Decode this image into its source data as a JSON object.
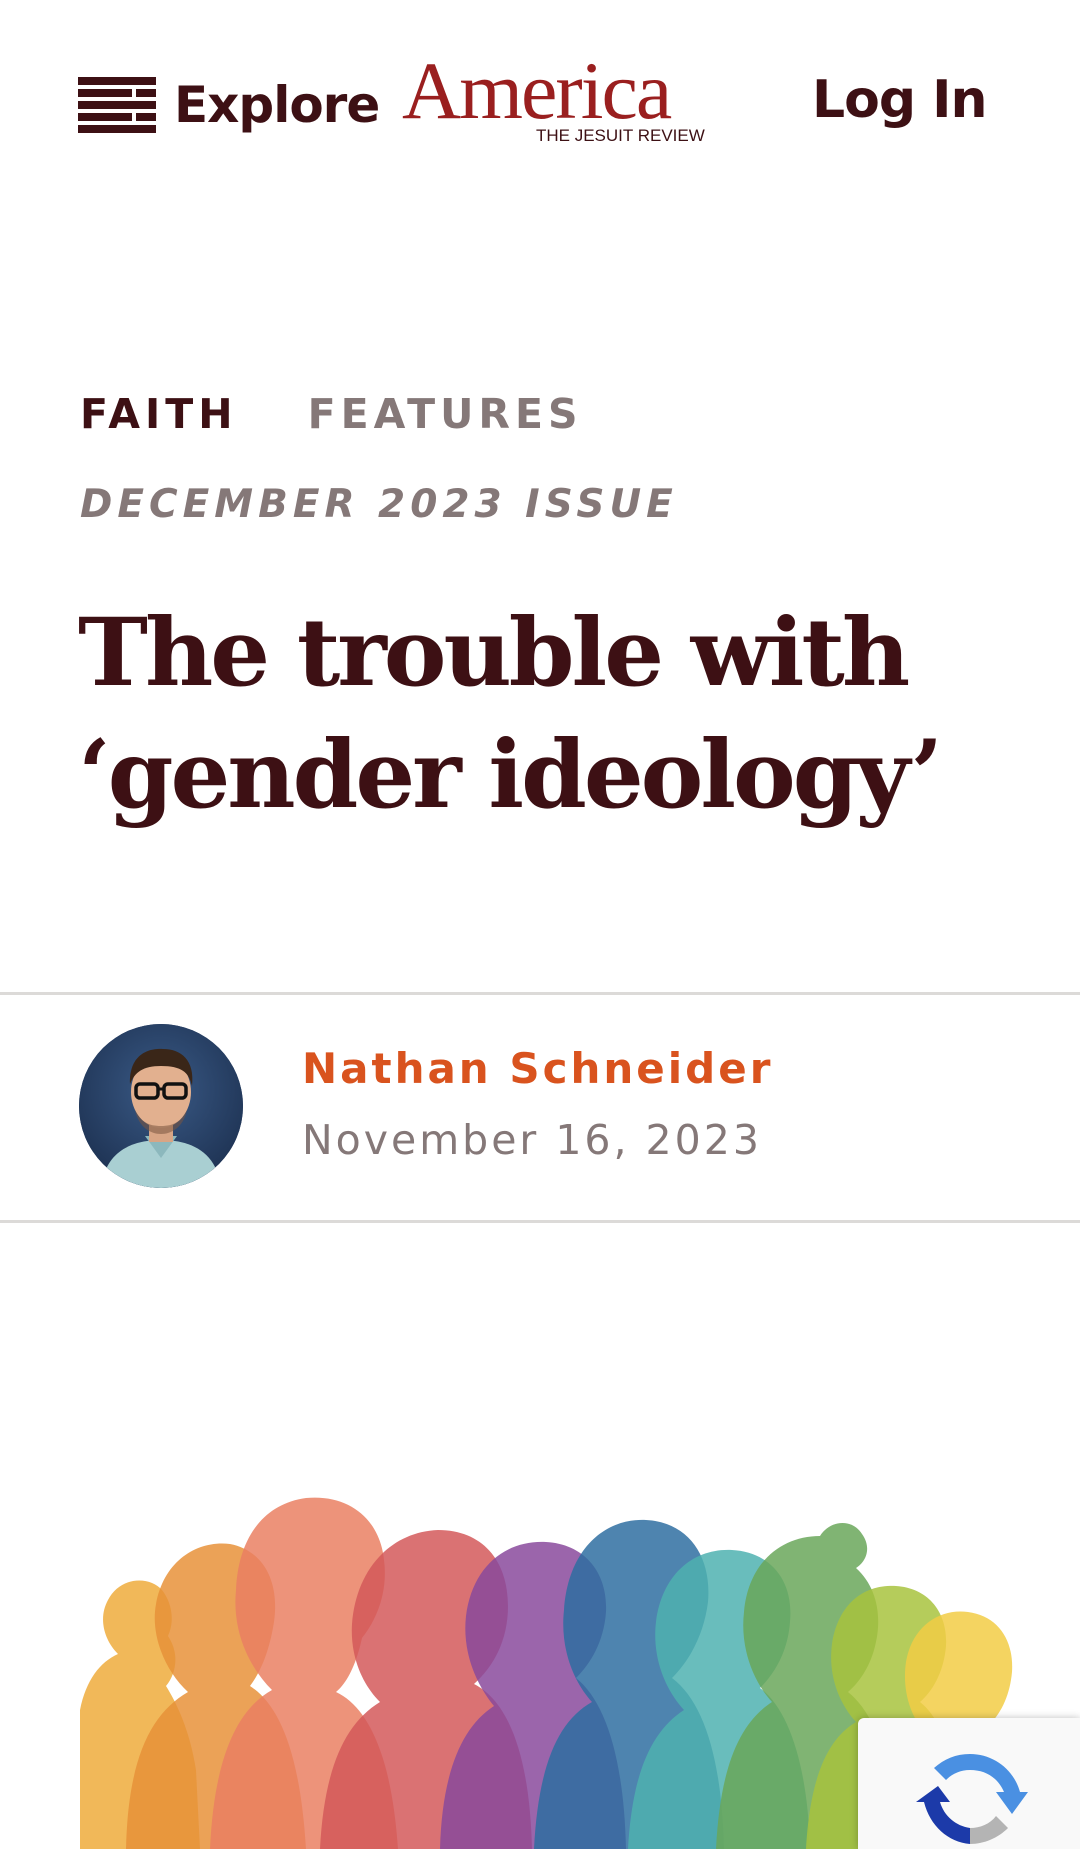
{
  "header": {
    "explore_label": "Explore",
    "logo_word": "America",
    "logo_tagline": "THE JESUIT REVIEW",
    "login_label": "Log In"
  },
  "article": {
    "category_primary": "FAITH",
    "category_secondary": "FEATURES",
    "issue": "DECEMBER 2023 ISSUE",
    "title_line1": "The trouble with",
    "title_line2": "‘gender ideology’",
    "author": "Nathan Schneider",
    "date": "November 16, 2023"
  },
  "colors": {
    "text_dark": "#3d1014",
    "logo_red": "#9a1f1f",
    "author_orange": "#d9531e",
    "muted_gray": "#857878",
    "divider": "#dcdad8",
    "silhouettes": [
      "#f0b047",
      "#e7923a",
      "#ea8063",
      "#d4595b",
      "#8a4a9c",
      "#2f6fa1",
      "#4fb1b0",
      "#6aa75a",
      "#a8c33e",
      "#f2cc45"
    ]
  },
  "icons": {
    "menu": "hamburger-menu-icon",
    "recaptcha": "recaptcha-logo-icon"
  }
}
